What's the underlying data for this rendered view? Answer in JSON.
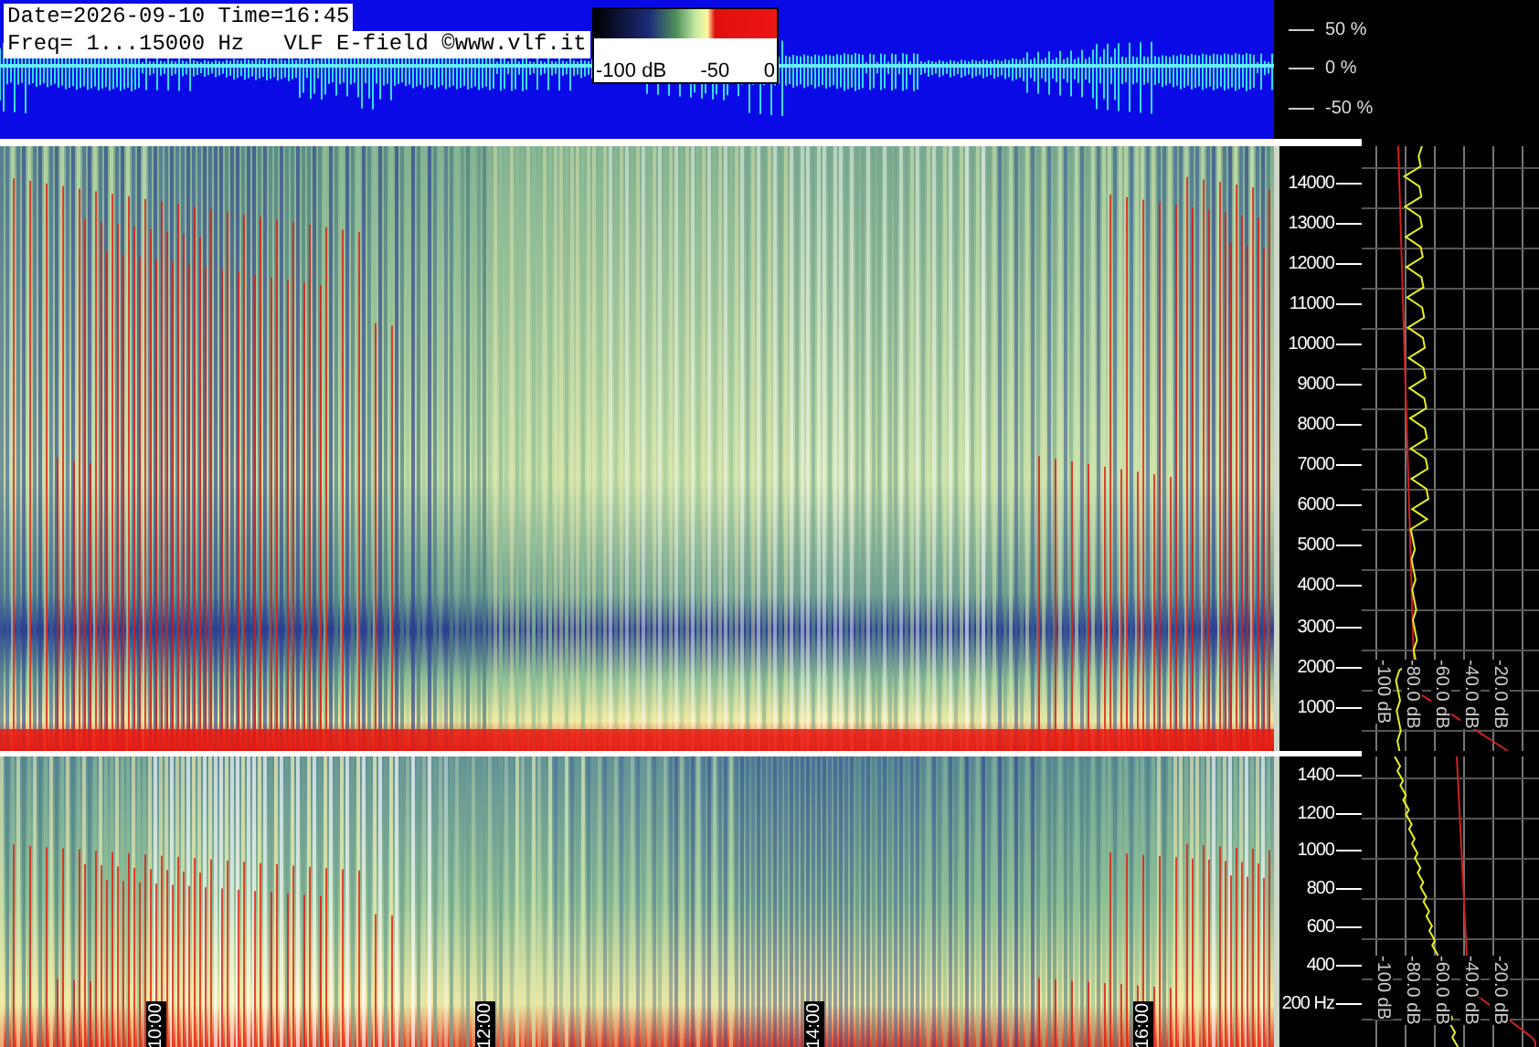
{
  "header": {
    "date_line": "Date=2026-09-10 Time=16:45",
    "freq_line": "Freq= 1...15000 Hz   VLF E-field ©www.vlf.it"
  },
  "colorbar": {
    "labels": [
      "-100 dB",
      "-50",
      "0"
    ]
  },
  "waveform": {
    "ticks": [
      "50 %",
      "0 %",
      "-50 %"
    ]
  },
  "spectrogram_high": {
    "freq_labels": [
      "14000",
      "13000",
      "12000",
      "11000",
      "10000",
      "9000",
      "8000",
      "7000",
      "6000",
      "5000",
      "4000",
      "3000",
      "2000",
      "1000"
    ],
    "db_labels": [
      "-100 dB",
      "-80.0 dB",
      "-60.0 dB",
      "-40.0 dB",
      "-20.0 dB"
    ]
  },
  "spectrogram_low": {
    "freq_labels": [
      "1400",
      "1200",
      "1000",
      "800",
      "600",
      "400",
      "200 Hz"
    ],
    "db_labels": [
      "-100 dB",
      "-80.0 dB",
      "-60.0 dB",
      "-40.0 dB",
      "-20.0 dB"
    ]
  },
  "time_labels": [
    "10:00",
    "12:00",
    "14:00",
    "16:00"
  ]
}
